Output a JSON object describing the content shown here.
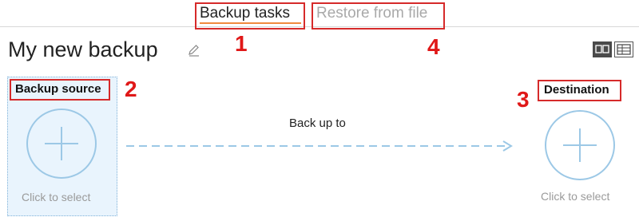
{
  "tabs": {
    "backup_tasks": "Backup tasks",
    "restore_from_file": "Restore from file"
  },
  "header": {
    "title": "My new backup"
  },
  "source": {
    "label": "Backup source",
    "hint": "Click to select"
  },
  "arrow": {
    "label": "Back up to"
  },
  "destination": {
    "label": "Destination",
    "hint": "Click to select"
  },
  "annotations": {
    "n1": "1",
    "n2": "2",
    "n3": "3",
    "n4": "4"
  },
  "icons": {
    "edit": "pencil-icon",
    "add_source": "plus-circle-icon",
    "add_destination": "plus-circle-icon",
    "view_tiles": "tiles-view-icon",
    "view_list": "list-view-icon"
  },
  "colors": {
    "accent_underline": "#f08a3e",
    "annotation_red": "#e01818",
    "plus_blue": "#9cc8e6",
    "source_bg": "#e9f4fd",
    "arrow_dashes": "#9cc8e6"
  }
}
